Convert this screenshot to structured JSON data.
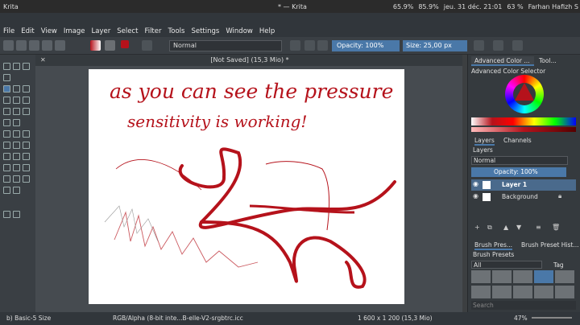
{
  "system": {
    "app_name": "Krita",
    "window_title": "* — Krita",
    "battery": "65.9%",
    "battery2": "85.9%",
    "datetime": "jeu. 31 déc. 21:01",
    "volume": "63 %",
    "user": "Farhan Hafizh S"
  },
  "menu": [
    "File",
    "Edit",
    "View",
    "Image",
    "Layer",
    "Select",
    "Filter",
    "Tools",
    "Settings",
    "Window",
    "Help"
  ],
  "toolbar": {
    "blend_mode": "Normal",
    "opacity": "Opacity: 100%",
    "size": "Size: 25,00 px"
  },
  "document": {
    "title": "[Not Saved]  (15,3 Mio) *",
    "handwriting_line1": "as you can see the pressure",
    "handwriting_line2": "sensitivity is working!"
  },
  "dock": {
    "tab_color": "Advanced Color ...",
    "tab_tool": "Tool...",
    "color_selector_label": "Advanced Color Selector",
    "layers_tab": "Layers",
    "channels_tab": "Channels",
    "layers_label": "Layers",
    "layer_blend": "Normal",
    "layer_opacity": "Opacity:  100%",
    "layers": [
      {
        "name": "Layer 1",
        "selected": true
      },
      {
        "name": "Background",
        "selected": false
      }
    ],
    "brush_presets_tab": "Brush Pres...",
    "brush_history_tab": "Brush Preset Hist...",
    "brush_presets_label": "Brush Presets",
    "brush_filter": "All",
    "brush_tag": "Tag",
    "search_placeholder": "Search"
  },
  "status": {
    "brush": "b) Basic-5 Size",
    "color_space": "RGB/Alpha (8-bit inte...B-elle-V2-srgbtrc.icc",
    "dimensions": "1 600 x 1 200 (15,3 Mio)",
    "zoom": "47%"
  },
  "colors": {
    "stroke_red": "#b5121b",
    "accent_blue": "#4a78a8"
  }
}
